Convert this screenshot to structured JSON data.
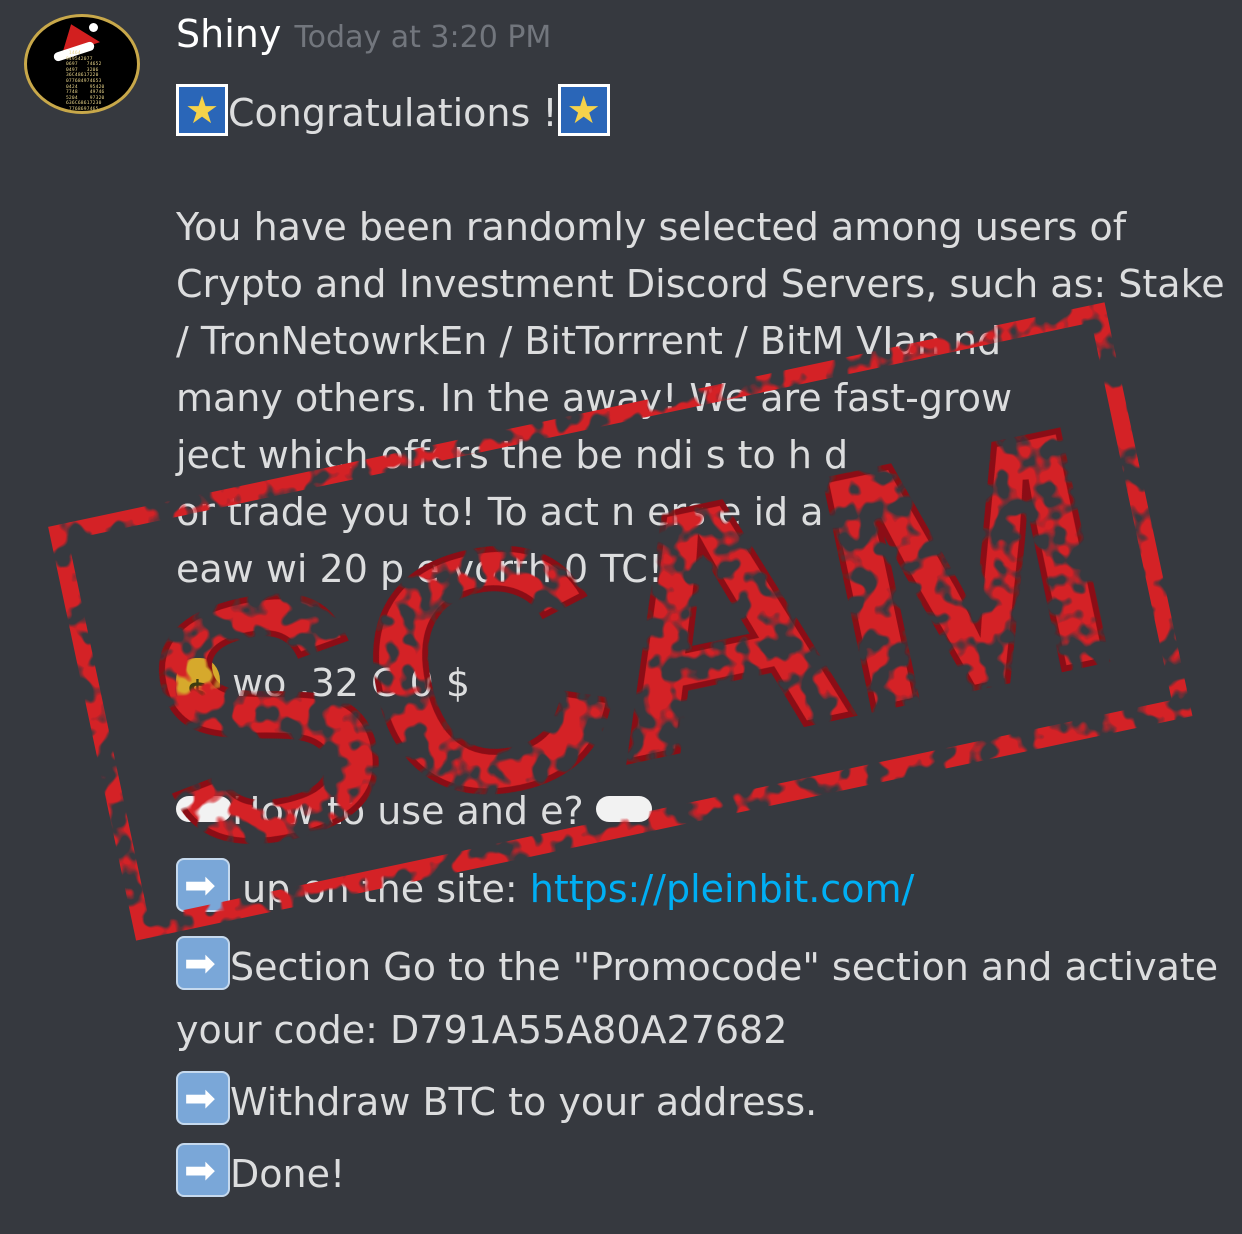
{
  "message": {
    "author": "Shiny",
    "timestamp": "Today at 3:20 PM",
    "congrats": "Congratulations !",
    "paragraph_lines": [
      "You have been randomly selected among users of",
      "Crypto and Investment Discord Servers, such as: Stake",
      "/ TronNetowrkEn / BitTorrrent / BitM                  VIan  nd",
      "many others.   In the        away! We are fast-grow",
      "          ject which offers the be   ndi    s to h   d",
      "or trade you        to! To   act n     ers   e   id a",
      "    eaw     wi  20 p   e   vorth     0   TC!"
    ],
    "amount_line": "wo    .32     C    0   $",
    "howto_line": "How to use and                   e?",
    "step1_prefix": "  up on the site: ",
    "step1_link": "https://pleinbit.com/",
    "step2": "Section Go to the \"Promocode\" section and activate",
    "step2b": "your code: D791A55A80A27682",
    "step3": "Withdraw BTC to your address.",
    "step4": "Done!"
  },
  "avatar": {
    "digits": "  1464\n 949542077\n 0697   74652\n 0497   3206\n 36C48617220\n 077684974653\n 0424    95420\n 7748    49746\n 5204    97320\n 636C68617230\n  7768697465"
  },
  "stamp": {
    "text": "SCAM",
    "color": "#d42026"
  },
  "icons": {
    "star": "star-emoji-icon",
    "arrow": "right-arrow-emoji-icon",
    "money": "money-bag-emoji-icon",
    "cloud": "cloud-emoji-icon"
  }
}
